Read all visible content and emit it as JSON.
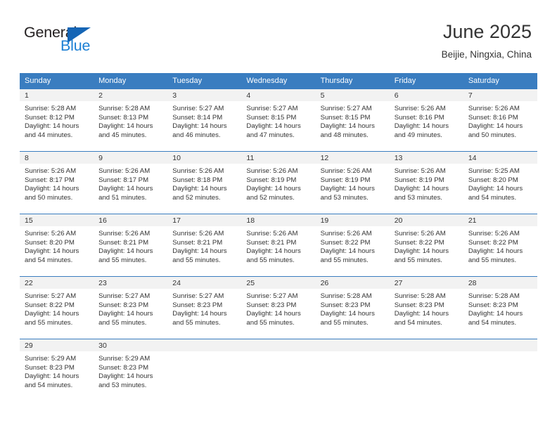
{
  "brand": {
    "name_top": "General",
    "name_bottom": "Blue",
    "triangle_icon": "triangle-icon",
    "top_color": "#231f20",
    "bottom_color": "#1b7fd4",
    "triangle_color": "#1565b5"
  },
  "header": {
    "title": "June 2025",
    "subtitle": "Beijie, Ningxia, China"
  },
  "theme": {
    "header_bg": "#3a7dc0",
    "header_text": "#ffffff",
    "daynum_bg": "#f2f2f2",
    "body_text": "#333333"
  },
  "calendar": {
    "weekday_headers": [
      "Sunday",
      "Monday",
      "Tuesday",
      "Wednesday",
      "Thursday",
      "Friday",
      "Saturday"
    ],
    "weeks": [
      [
        {
          "day": "1",
          "sunrise": "Sunrise: 5:28 AM",
          "sunset": "Sunset: 8:12 PM",
          "daylight_line1": "Daylight: 14 hours",
          "daylight_line2": "and 44 minutes."
        },
        {
          "day": "2",
          "sunrise": "Sunrise: 5:28 AM",
          "sunset": "Sunset: 8:13 PM",
          "daylight_line1": "Daylight: 14 hours",
          "daylight_line2": "and 45 minutes."
        },
        {
          "day": "3",
          "sunrise": "Sunrise: 5:27 AM",
          "sunset": "Sunset: 8:14 PM",
          "daylight_line1": "Daylight: 14 hours",
          "daylight_line2": "and 46 minutes."
        },
        {
          "day": "4",
          "sunrise": "Sunrise: 5:27 AM",
          "sunset": "Sunset: 8:15 PM",
          "daylight_line1": "Daylight: 14 hours",
          "daylight_line2": "and 47 minutes."
        },
        {
          "day": "5",
          "sunrise": "Sunrise: 5:27 AM",
          "sunset": "Sunset: 8:15 PM",
          "daylight_line1": "Daylight: 14 hours",
          "daylight_line2": "and 48 minutes."
        },
        {
          "day": "6",
          "sunrise": "Sunrise: 5:26 AM",
          "sunset": "Sunset: 8:16 PM",
          "daylight_line1": "Daylight: 14 hours",
          "daylight_line2": "and 49 minutes."
        },
        {
          "day": "7",
          "sunrise": "Sunrise: 5:26 AM",
          "sunset": "Sunset: 8:16 PM",
          "daylight_line1": "Daylight: 14 hours",
          "daylight_line2": "and 50 minutes."
        }
      ],
      [
        {
          "day": "8",
          "sunrise": "Sunrise: 5:26 AM",
          "sunset": "Sunset: 8:17 PM",
          "daylight_line1": "Daylight: 14 hours",
          "daylight_line2": "and 50 minutes."
        },
        {
          "day": "9",
          "sunrise": "Sunrise: 5:26 AM",
          "sunset": "Sunset: 8:17 PM",
          "daylight_line1": "Daylight: 14 hours",
          "daylight_line2": "and 51 minutes."
        },
        {
          "day": "10",
          "sunrise": "Sunrise: 5:26 AM",
          "sunset": "Sunset: 8:18 PM",
          "daylight_line1": "Daylight: 14 hours",
          "daylight_line2": "and 52 minutes."
        },
        {
          "day": "11",
          "sunrise": "Sunrise: 5:26 AM",
          "sunset": "Sunset: 8:19 PM",
          "daylight_line1": "Daylight: 14 hours",
          "daylight_line2": "and 52 minutes."
        },
        {
          "day": "12",
          "sunrise": "Sunrise: 5:26 AM",
          "sunset": "Sunset: 8:19 PM",
          "daylight_line1": "Daylight: 14 hours",
          "daylight_line2": "and 53 minutes."
        },
        {
          "day": "13",
          "sunrise": "Sunrise: 5:26 AM",
          "sunset": "Sunset: 8:19 PM",
          "daylight_line1": "Daylight: 14 hours",
          "daylight_line2": "and 53 minutes."
        },
        {
          "day": "14",
          "sunrise": "Sunrise: 5:25 AM",
          "sunset": "Sunset: 8:20 PM",
          "daylight_line1": "Daylight: 14 hours",
          "daylight_line2": "and 54 minutes."
        }
      ],
      [
        {
          "day": "15",
          "sunrise": "Sunrise: 5:26 AM",
          "sunset": "Sunset: 8:20 PM",
          "daylight_line1": "Daylight: 14 hours",
          "daylight_line2": "and 54 minutes."
        },
        {
          "day": "16",
          "sunrise": "Sunrise: 5:26 AM",
          "sunset": "Sunset: 8:21 PM",
          "daylight_line1": "Daylight: 14 hours",
          "daylight_line2": "and 55 minutes."
        },
        {
          "day": "17",
          "sunrise": "Sunrise: 5:26 AM",
          "sunset": "Sunset: 8:21 PM",
          "daylight_line1": "Daylight: 14 hours",
          "daylight_line2": "and 55 minutes."
        },
        {
          "day": "18",
          "sunrise": "Sunrise: 5:26 AM",
          "sunset": "Sunset: 8:21 PM",
          "daylight_line1": "Daylight: 14 hours",
          "daylight_line2": "and 55 minutes."
        },
        {
          "day": "19",
          "sunrise": "Sunrise: 5:26 AM",
          "sunset": "Sunset: 8:22 PM",
          "daylight_line1": "Daylight: 14 hours",
          "daylight_line2": "and 55 minutes."
        },
        {
          "day": "20",
          "sunrise": "Sunrise: 5:26 AM",
          "sunset": "Sunset: 8:22 PM",
          "daylight_line1": "Daylight: 14 hours",
          "daylight_line2": "and 55 minutes."
        },
        {
          "day": "21",
          "sunrise": "Sunrise: 5:26 AM",
          "sunset": "Sunset: 8:22 PM",
          "daylight_line1": "Daylight: 14 hours",
          "daylight_line2": "and 55 minutes."
        }
      ],
      [
        {
          "day": "22",
          "sunrise": "Sunrise: 5:27 AM",
          "sunset": "Sunset: 8:22 PM",
          "daylight_line1": "Daylight: 14 hours",
          "daylight_line2": "and 55 minutes."
        },
        {
          "day": "23",
          "sunrise": "Sunrise: 5:27 AM",
          "sunset": "Sunset: 8:23 PM",
          "daylight_line1": "Daylight: 14 hours",
          "daylight_line2": "and 55 minutes."
        },
        {
          "day": "24",
          "sunrise": "Sunrise: 5:27 AM",
          "sunset": "Sunset: 8:23 PM",
          "daylight_line1": "Daylight: 14 hours",
          "daylight_line2": "and 55 minutes."
        },
        {
          "day": "25",
          "sunrise": "Sunrise: 5:27 AM",
          "sunset": "Sunset: 8:23 PM",
          "daylight_line1": "Daylight: 14 hours",
          "daylight_line2": "and 55 minutes."
        },
        {
          "day": "26",
          "sunrise": "Sunrise: 5:28 AM",
          "sunset": "Sunset: 8:23 PM",
          "daylight_line1": "Daylight: 14 hours",
          "daylight_line2": "and 55 minutes."
        },
        {
          "day": "27",
          "sunrise": "Sunrise: 5:28 AM",
          "sunset": "Sunset: 8:23 PM",
          "daylight_line1": "Daylight: 14 hours",
          "daylight_line2": "and 54 minutes."
        },
        {
          "day": "28",
          "sunrise": "Sunrise: 5:28 AM",
          "sunset": "Sunset: 8:23 PM",
          "daylight_line1": "Daylight: 14 hours",
          "daylight_line2": "and 54 minutes."
        }
      ],
      [
        {
          "day": "29",
          "sunrise": "Sunrise: 5:29 AM",
          "sunset": "Sunset: 8:23 PM",
          "daylight_line1": "Daylight: 14 hours",
          "daylight_line2": "and 54 minutes."
        },
        {
          "day": "30",
          "sunrise": "Sunrise: 5:29 AM",
          "sunset": "Sunset: 8:23 PM",
          "daylight_line1": "Daylight: 14 hours",
          "daylight_line2": "and 53 minutes."
        },
        {
          "day": "",
          "sunrise": "",
          "sunset": "",
          "daylight_line1": "",
          "daylight_line2": ""
        },
        {
          "day": "",
          "sunrise": "",
          "sunset": "",
          "daylight_line1": "",
          "daylight_line2": ""
        },
        {
          "day": "",
          "sunrise": "",
          "sunset": "",
          "daylight_line1": "",
          "daylight_line2": ""
        },
        {
          "day": "",
          "sunrise": "",
          "sunset": "",
          "daylight_line1": "",
          "daylight_line2": ""
        },
        {
          "day": "",
          "sunrise": "",
          "sunset": "",
          "daylight_line1": "",
          "daylight_line2": ""
        }
      ]
    ]
  }
}
